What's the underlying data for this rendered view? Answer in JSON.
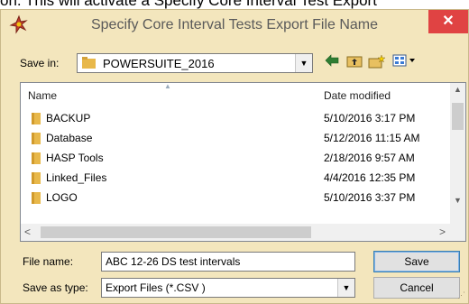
{
  "background_text": "on. This will activate a Specify Core Interval Test Export",
  "window": {
    "title": "Specify Core Interval Tests Export File Name",
    "close_label": "✕"
  },
  "save_in": {
    "label": "Save in:",
    "value": "POWERSUITE_2016"
  },
  "list": {
    "col_name": "Name",
    "col_date": "Date modified",
    "items": [
      {
        "name": "BACKUP",
        "date": "5/10/2016 3:17 PM"
      },
      {
        "name": "Database",
        "date": "5/12/2016 11:15 AM"
      },
      {
        "name": "HASP Tools",
        "date": "2/18/2016 9:57 AM"
      },
      {
        "name": "Linked_Files",
        "date": "4/4/2016 12:35 PM"
      },
      {
        "name": "LOGO",
        "date": "5/10/2016 3:37 PM"
      }
    ]
  },
  "file_name": {
    "label": "File name:",
    "value": "ABC 12-26 DS test intervals"
  },
  "save_as_type": {
    "label": "Save as type:",
    "value": "Export Files (*.CSV )"
  },
  "buttons": {
    "save": "Save",
    "cancel": "Cancel"
  },
  "colors": {
    "dialog_bg": "#f3e6bd",
    "close_bg": "#e04343",
    "folder": "#e8b84a"
  }
}
